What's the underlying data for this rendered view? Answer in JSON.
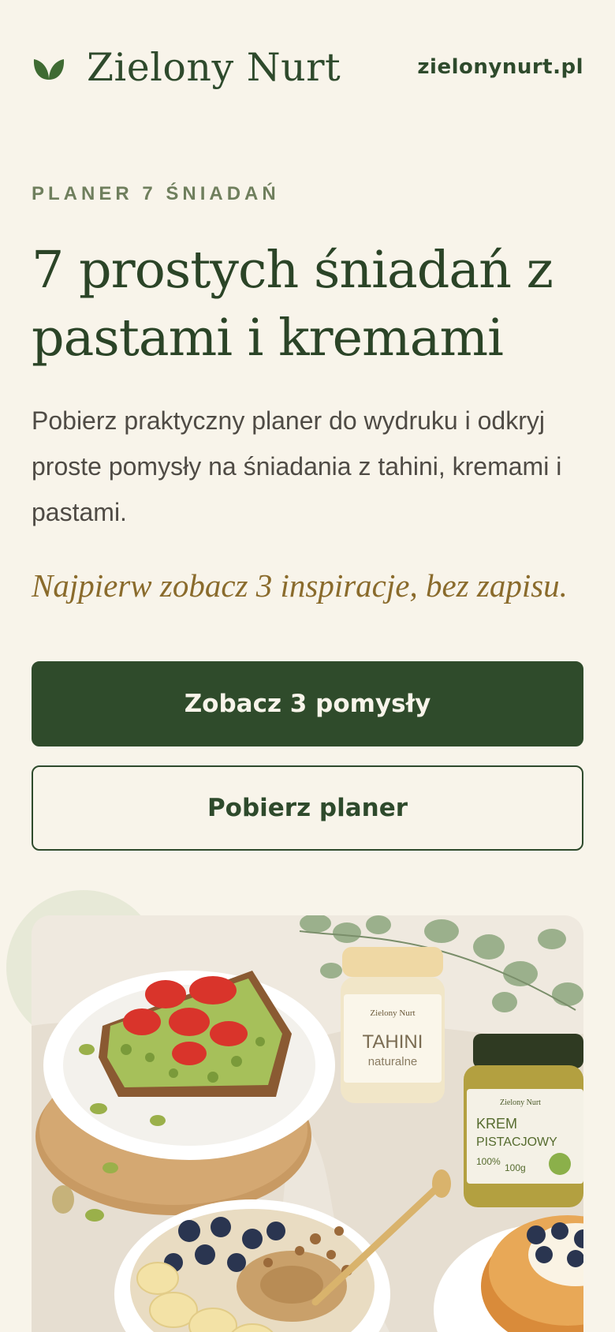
{
  "header": {
    "brand_name": "Zielony Nurt",
    "site_link": "zielonynurt.pl",
    "logo_icon": "leaf-icon"
  },
  "hero": {
    "eyebrow": "PLANER 7 ŚNIADAŃ",
    "headline": "7 prostych śniadań z pastami i kremami",
    "lead": "Pobierz praktyczny planer do wydruku i odkryj proste pomysły na śniadania z tahini, kremami i pastami.",
    "note": "Najpierw zobacz 3 inspiracje, bez zapisu.",
    "primary_button": "Zobacz 3 pomysły",
    "secondary_button": "Pobierz planer"
  },
  "image": {
    "jar_tahini_brand": "Zielony Nurt",
    "jar_tahini_title": "TAHINI",
    "jar_tahini_subtitle": "naturalne",
    "jar_pistachio_brand": "Zielony Nurt",
    "jar_pistachio_title_1": "KREM",
    "jar_pistachio_title_2": "PISTACJOWY",
    "jar_pistachio_pct": "100%",
    "jar_pistachio_weight": "100g"
  },
  "colors": {
    "background": "#f8f4ea",
    "primary_green": "#2f4b2b",
    "accent_gold": "#8a6b2c",
    "leaf_green": "#3f6b33"
  }
}
